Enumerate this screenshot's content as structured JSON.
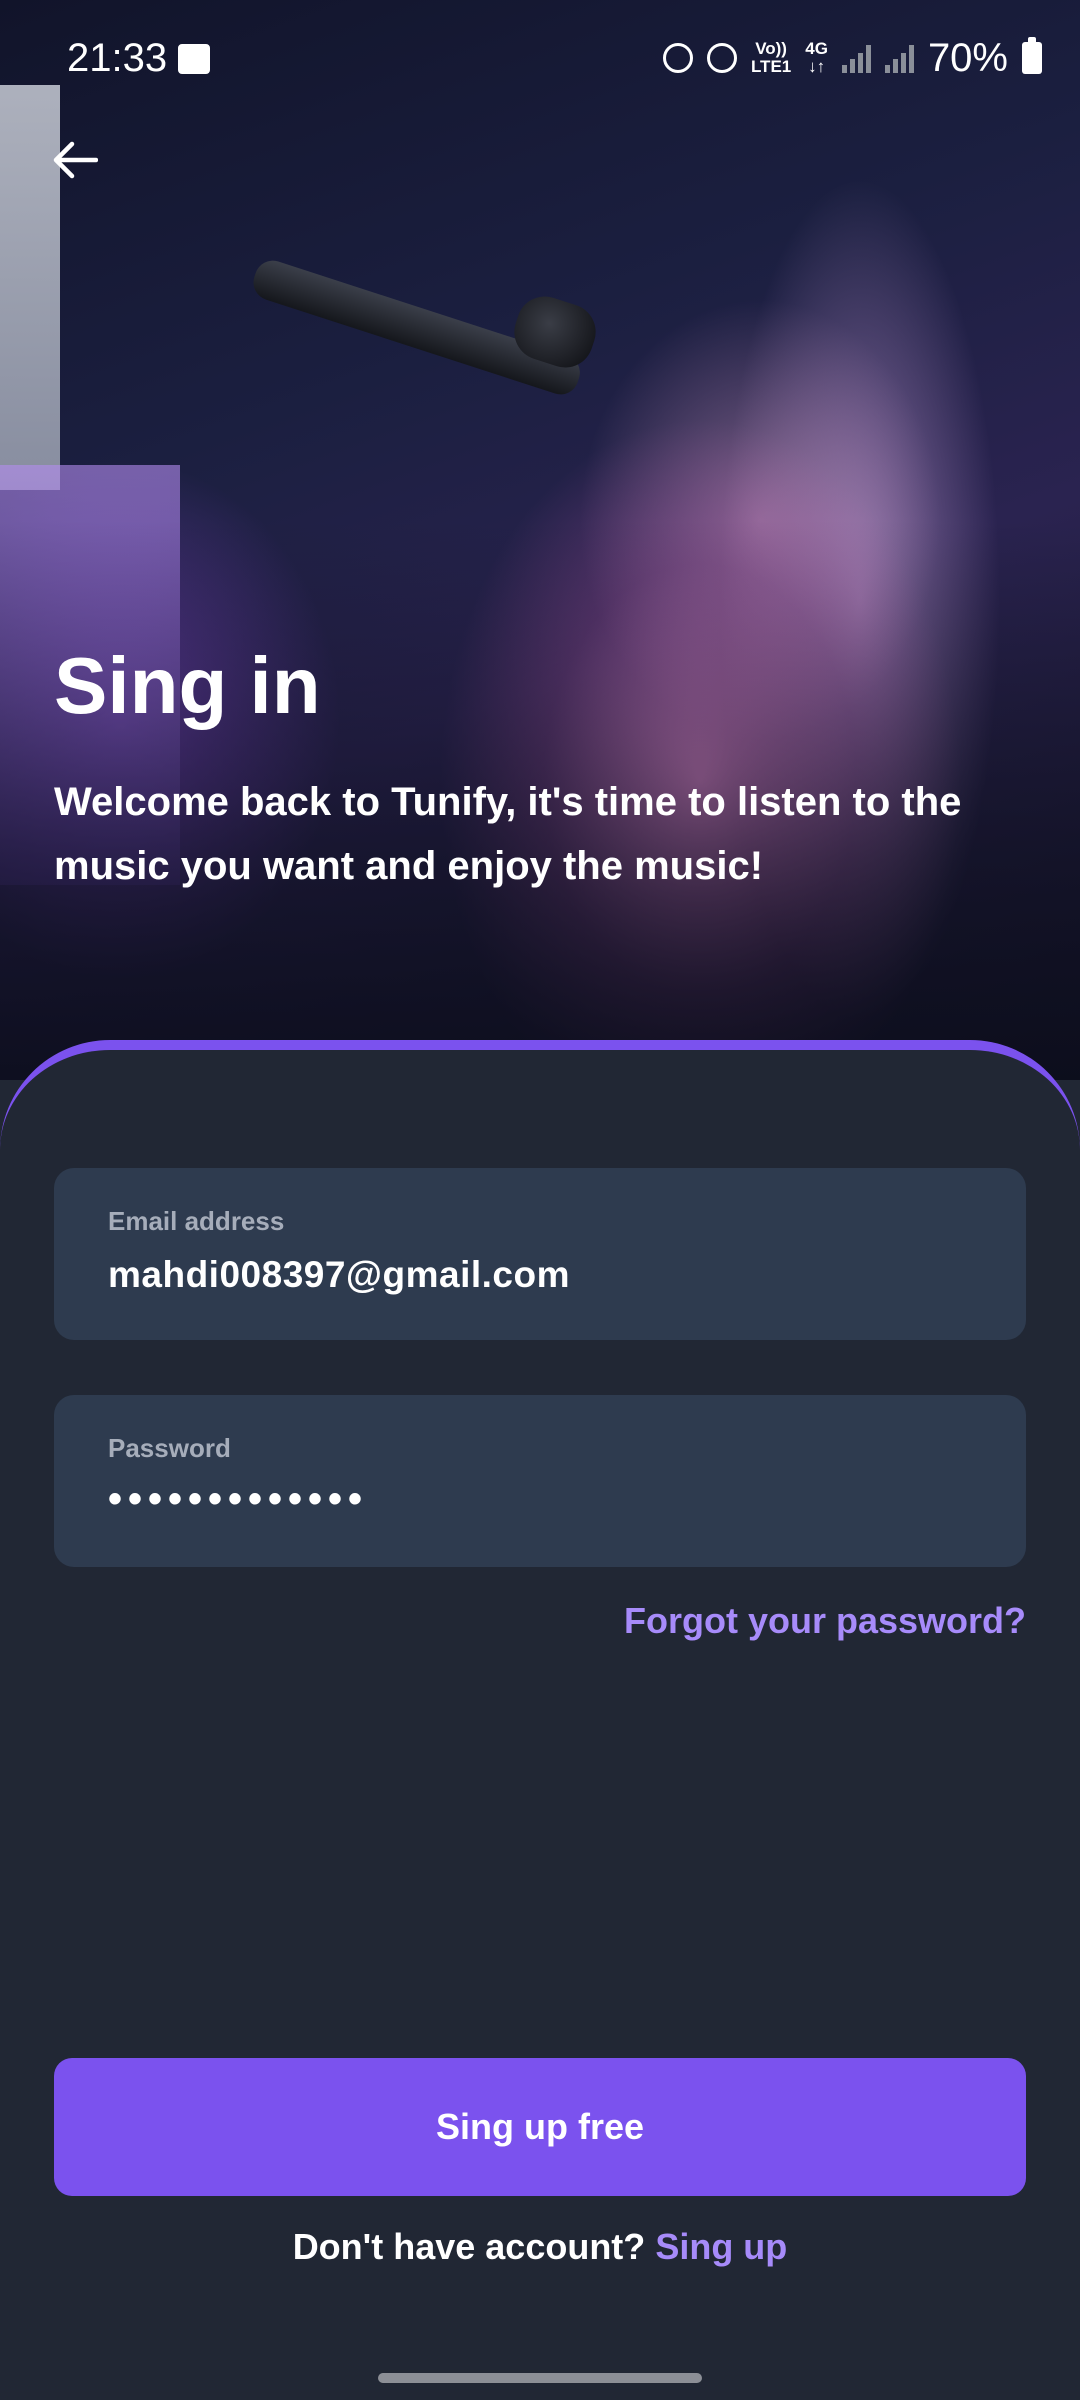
{
  "status_bar": {
    "time": "21:33",
    "network_top": "Vo))",
    "network_bottom": "LTE1",
    "data_top": "4G",
    "data_bottom": "↓↑",
    "battery": "70%"
  },
  "header": {
    "title": "Sing in",
    "subtitle": "Welcome back to Tunify, it's time to listen to the music you want and enjoy the music!"
  },
  "form": {
    "email": {
      "label": "Email address",
      "value": "mahdi008397@gmail.com"
    },
    "password": {
      "label": "Password",
      "value": "•••••••••••••"
    },
    "forgot_label": "Forgot your password?"
  },
  "actions": {
    "primary_label": "Sing up free",
    "no_account_text": "Don't have account?",
    "signup_link": "Sing up"
  },
  "colors": {
    "accent": "#7b52ee",
    "link": "#a78bfa",
    "background": "#212734",
    "field_bg": "#2e3b4f"
  }
}
